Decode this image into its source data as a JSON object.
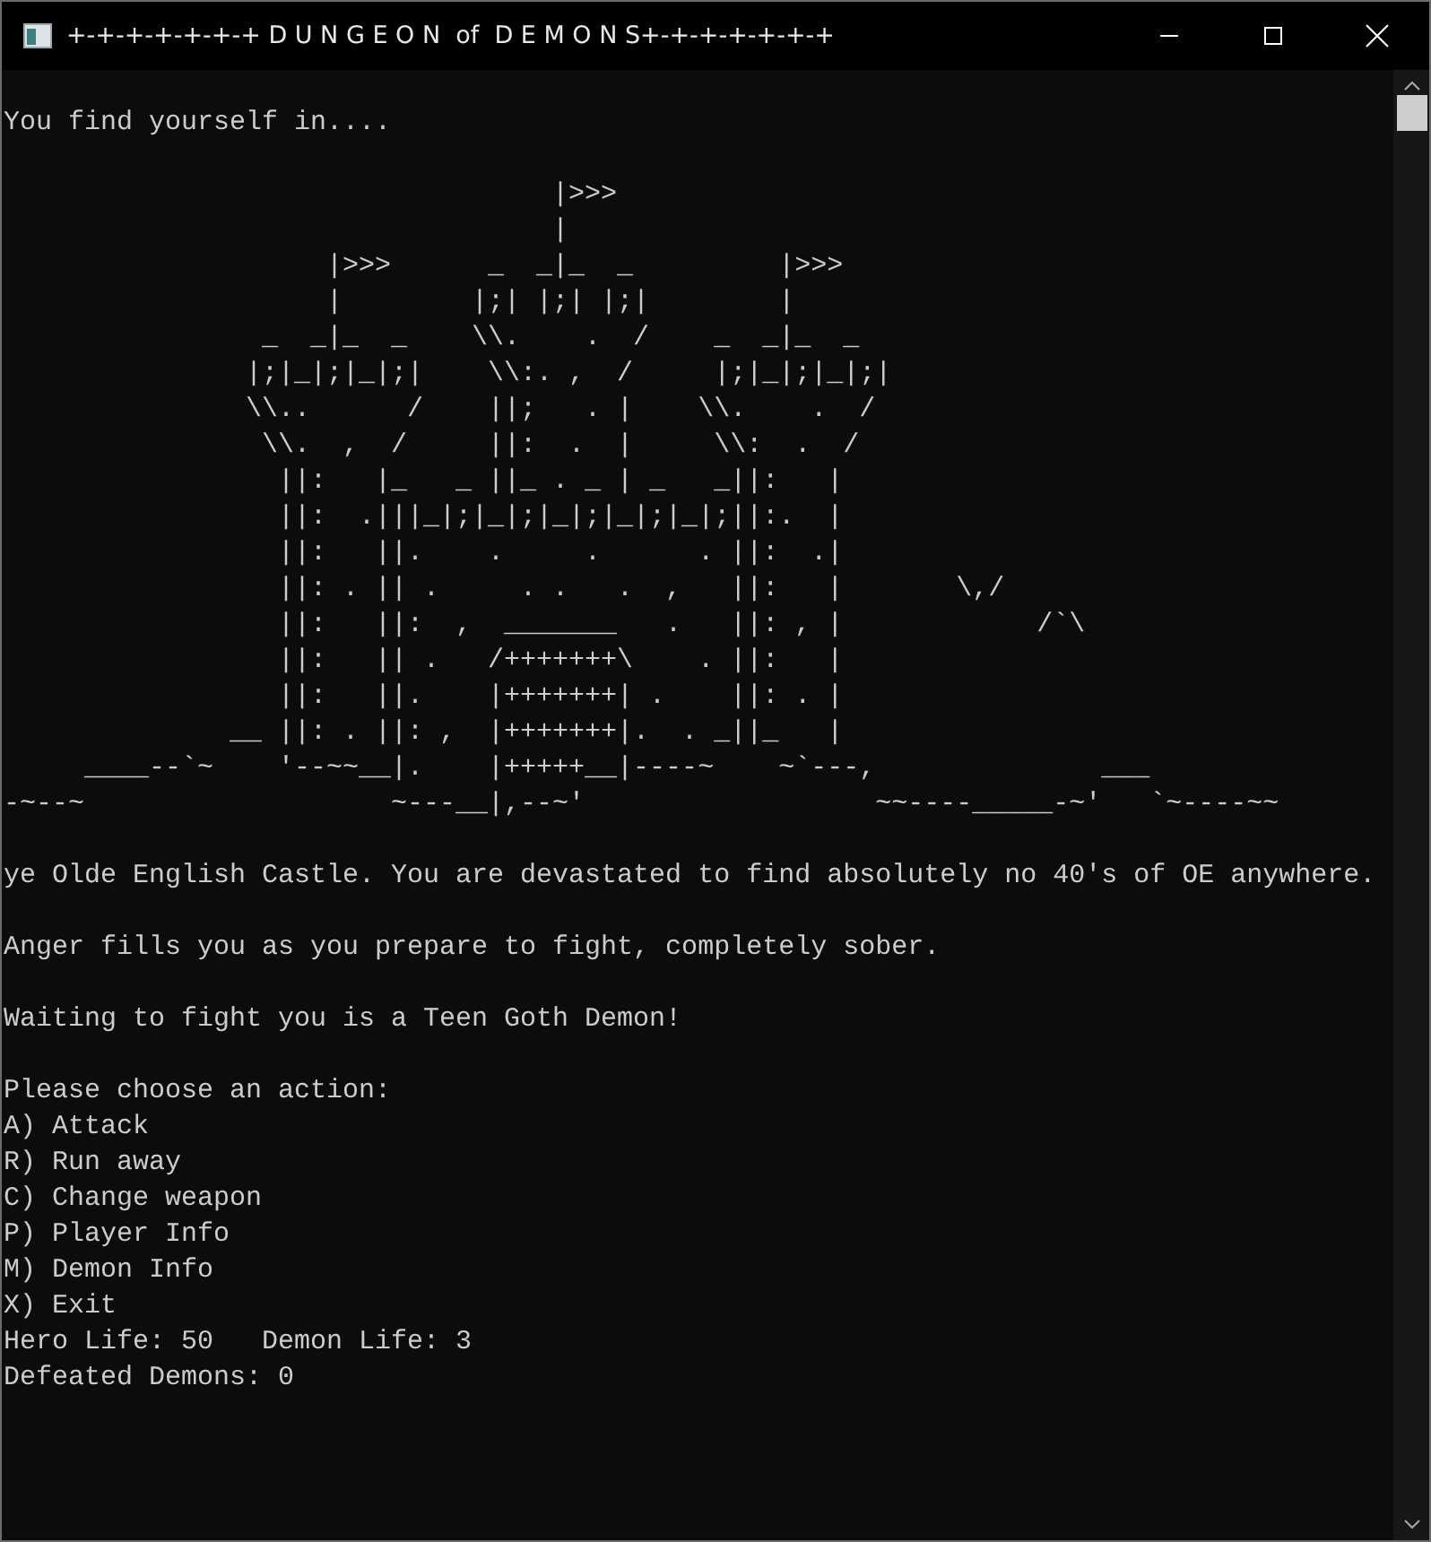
{
  "window": {
    "title": "+-+-+-+-+-+-+ D U N G E O N  of  D E M O N S+-+-+-+-+-+-+"
  },
  "console": {
    "blocks": [
      {
        "kind": "gap"
      },
      {
        "kind": "text",
        "text": "You find yourself in...."
      },
      {
        "kind": "gap"
      },
      {
        "kind": "art",
        "lines": [
          "                                  |>>>",
          "                                  |",
          "                    |>>>      _  _|_  _         |>>>",
          "                    |        |;| |;| |;|        |",
          "                _  _|_  _    \\\\.    .  /    _  _|_  _",
          "               |;|_|;|_|;|    \\\\:. ,  /     |;|_|;|_|;|",
          "               \\\\..      /    ||;   . |    \\\\.    .  /",
          "                \\\\.  ,  /     ||:  .  |     \\\\:  .  /",
          "                 ||:   |_   _ ||_ . _ | _   _||:   |",
          "                 ||:  .|||_|;|_|;|_|;|_|;|_|;||:.  |",
          "                 ||:   ||.    .     .      . ||:  .|",
          "                 ||: . || .     . .   .  ,   ||:   |       \\,/",
          "                 ||:   ||:  ,  _______   .   ||: , |            /`\\",
          "                 ||:   || .   /+++++++\\    . ||:   |",
          "                 ||:   ||.    |+++++++| .    ||: . |",
          "              __ ||: . ||: ,  |+++++++|.  . _||_   |",
          "     ____--`~    '--~~__|.    |+++++__|----~    ~`---,              ___",
          "-~--~                   ~---__|,--~'                  ~~----_____-~'   `~----~~"
        ]
      },
      {
        "kind": "gap"
      },
      {
        "kind": "text",
        "text": "ye Olde English Castle. You are devastated to find absolutely no 40's of OE anywhere."
      },
      {
        "kind": "gap"
      },
      {
        "kind": "text",
        "text": "Anger fills you as you prepare to fight, completely sober."
      },
      {
        "kind": "gap"
      },
      {
        "kind": "text",
        "text": "Waiting to fight you is a Teen Goth Demon!"
      },
      {
        "kind": "gap"
      },
      {
        "kind": "text",
        "text": "Please choose an action:"
      },
      {
        "kind": "option",
        "text": "A) Attack"
      },
      {
        "kind": "option",
        "text": "R) Run away"
      },
      {
        "kind": "option",
        "text": "C) Change weapon"
      },
      {
        "kind": "option",
        "text": "P) Player Info"
      },
      {
        "kind": "option",
        "text": "M) Demon Info"
      },
      {
        "kind": "option",
        "text": "X) Exit"
      },
      {
        "kind": "text",
        "text": "Hero Life: 50   Demon Life: 3"
      },
      {
        "kind": "text",
        "text": "Defeated Demons: 0"
      }
    ]
  }
}
